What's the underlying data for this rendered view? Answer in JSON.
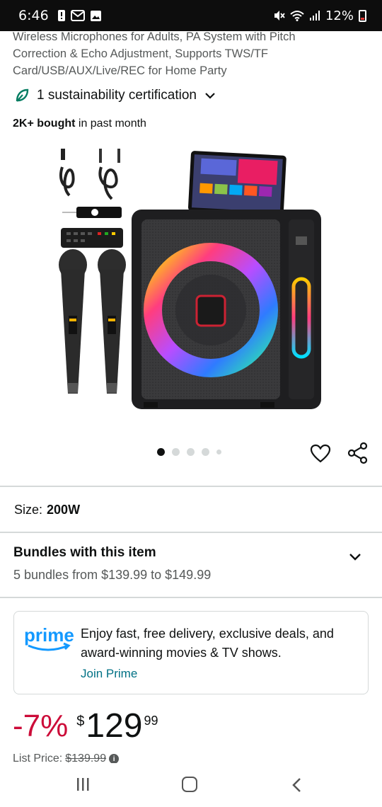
{
  "status_bar": {
    "time": "6:46",
    "battery": "12%",
    "icons_left": [
      "notification-icon",
      "gmail-icon",
      "gallery-icon"
    ],
    "icons_right": [
      "mute-icon",
      "wifi-icon",
      "signal-icon",
      "battery-icon"
    ]
  },
  "product": {
    "title": "Wireless Microphones for Adults, PA System with Pitch Correction & Echo Adjustment, Supports TWS/TF Card/USB/AUX/Live/REC for Home Party",
    "sustainability": "1 sustainability certification",
    "bought_bold": "2K+ bought",
    "bought_rest": " in past month",
    "image_count": 5,
    "active_image": 1
  },
  "size": {
    "label": "Size:",
    "value": "200W"
  },
  "bundles": {
    "title": "Bundles with this item",
    "subtitle": "5 bundles from $139.99 to $149.99"
  },
  "prime": {
    "logo_text": "prime",
    "message": "Enjoy fast, free delivery, exclusive deals, and award-winning movies & TV shows.",
    "join_label": "Join Prime"
  },
  "price": {
    "discount": "-7%",
    "currency": "$",
    "whole": "129",
    "fraction": "99",
    "list_price_label": "List Price:",
    "list_price_value": "$139.99"
  },
  "colors": {
    "link": "#007185",
    "discount": "#cc0c39",
    "prime_blue": "#1399ff"
  }
}
